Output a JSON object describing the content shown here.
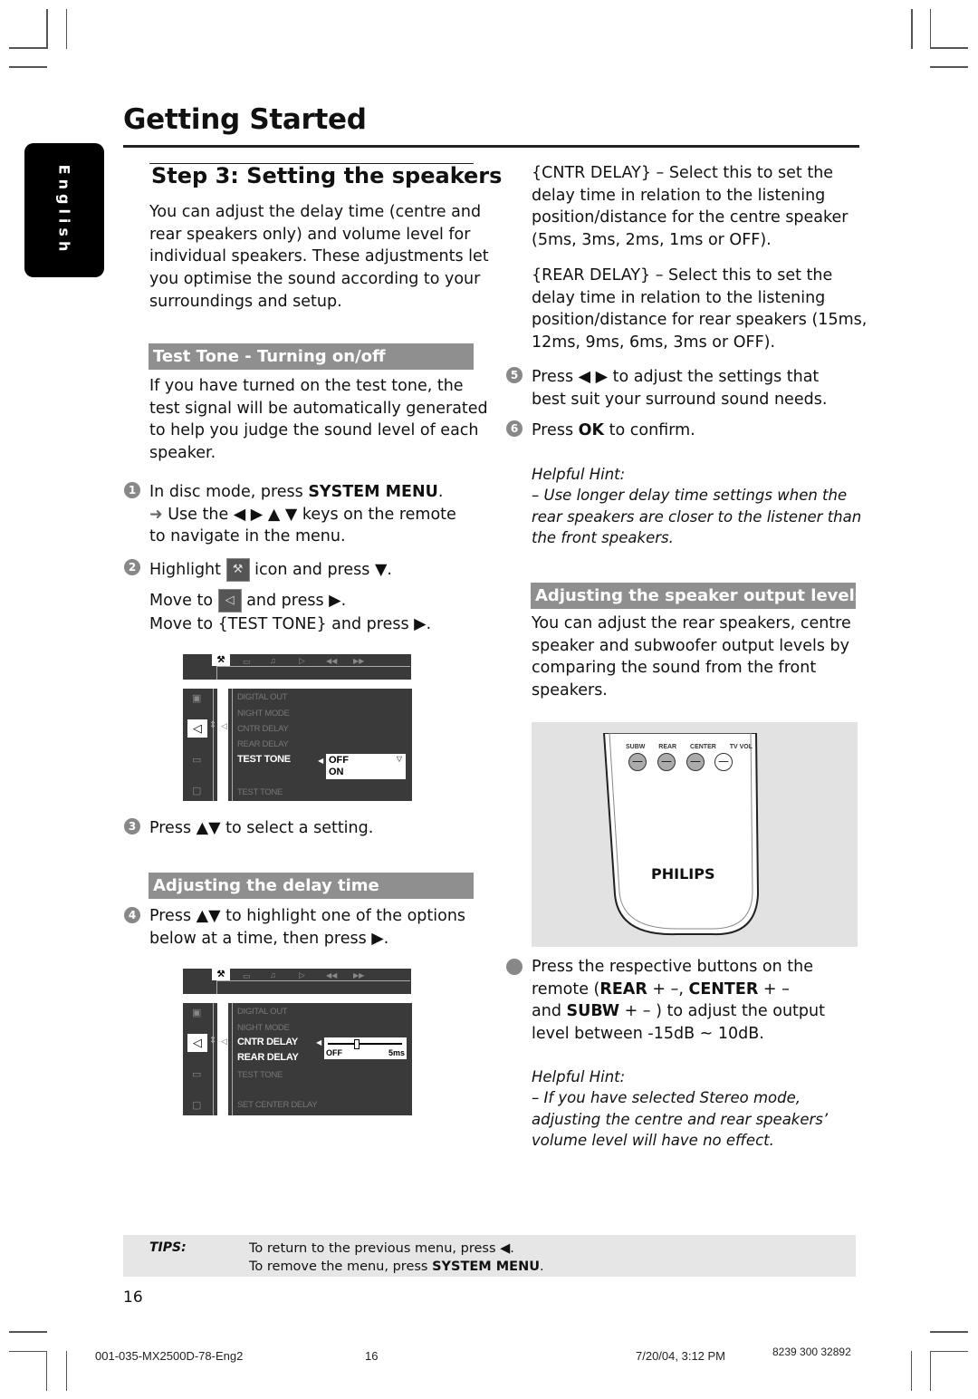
{
  "page": {
    "title": "Getting Started",
    "language_tab": "English",
    "page_number": "16"
  },
  "step": {
    "title": "Step 3:  Setting the speakers",
    "intro": [
      "You can adjust the delay time (centre and",
      "rear speakers only) and volume level for",
      "individual speakers. These adjustments let",
      "you optimise the sound according to your",
      "surroundings and setup."
    ]
  },
  "test_tone": {
    "heading": "Test Tone - Turning on/off",
    "intro": [
      "If you have turned on the test tone, the",
      "test signal will be automatically generated",
      "to help you judge the sound level of each",
      "speaker."
    ],
    "step1": {
      "num": "1",
      "text_a": "In disc mode, press ",
      "bold": "SYSTEM MENU",
      "text_b": ".",
      "arrow": "➜",
      "line2": "Use the ◀ ▶ ▲ ▼ keys on the remote",
      "line3": "to navigate in the menu."
    },
    "step2": {
      "num": "2",
      "a1": "Highlight ",
      "a2": " icon and press ▼.",
      "b1": "Move to ",
      "b2": " and press ▶.",
      "c": "Move to {TEST TONE} and press ▶."
    },
    "step3": {
      "num": "3",
      "text": "Press ▲▼ to select a setting."
    }
  },
  "osd1": {
    "tabs": [
      "settings-icon",
      "subtitle-icon",
      "audio-icon",
      "play-icon",
      "rewind-icon",
      "forward-icon"
    ],
    "menu": [
      "DIGITAL OUT",
      "NIGHT MODE",
      "CNTR DELAY",
      "REAR DELAY",
      "TEST TONE"
    ],
    "selected": "TEST TONE",
    "options": [
      "OFF",
      "ON"
    ],
    "footer": "TEST TONE"
  },
  "delay": {
    "heading": "Adjusting the delay time",
    "step4": {
      "num": "4",
      "line1": "Press ▲▼ to highlight one of the options",
      "line2": "below at a time, then press ▶."
    }
  },
  "osd2": {
    "menu": [
      "DIGITAL OUT",
      "NIGHT MODE",
      "CNTR DELAY",
      "REAR DELAY",
      "TEST TONE"
    ],
    "selected": [
      "CNTR DELAY",
      "REAR DELAY"
    ],
    "slider_min": "OFF",
    "slider_max": "5ms",
    "slider_value": 0.38,
    "footer": "SET CENTER DELAY"
  },
  "right": {
    "cntr": [
      "{CNTR DELAY} – Select this to set the",
      "delay time in relation to the listening",
      "position/distance for the centre speaker",
      "(5ms, 3ms, 2ms, 1ms or OFF)."
    ],
    "rear": [
      "{REAR DELAY} – Select this to set the",
      "delay time in relation to the listening",
      "position/distance for rear speakers (15ms,",
      "12ms, 9ms, 6ms, 3ms or OFF)."
    ],
    "step5": {
      "num": "5",
      "line1": "Press ◀ ▶  to adjust the settings that",
      "line2": "best suit your surround sound needs."
    },
    "step6": {
      "num": "6",
      "a": "Press ",
      "bold": "OK",
      "b": " to confirm."
    },
    "hint1": {
      "title": "Helpful Hint:",
      "lines": [
        "–  Use longer delay time settings when the",
        "rear speakers are closer to the listener than",
        "the front speakers."
      ]
    },
    "levels_heading": "Adjusting the speaker output levels",
    "levels_intro": [
      "You can adjust the rear speakers, centre",
      "speaker and subwoofer output levels by",
      "comparing the sound from the front",
      "speakers."
    ],
    "remote": {
      "labels": [
        "SUBW",
        "REAR",
        "CENTER",
        "TV VOL"
      ],
      "brand": "PHILIPS"
    },
    "bullet": {
      "l1": "Press the respective buttons on the",
      "l2a": "remote (",
      "l2b": "REAR",
      "l2c": " + –, ",
      "l2d": "CENTER",
      "l2e": " + –",
      "l3a": "and ",
      "l3b": "SUBW",
      "l3c": " + – ) to adjust the output",
      "l4": "level between -15dB ~ 10dB."
    },
    "hint2": {
      "title": "Helpful Hint:",
      "lines": [
        "–  If you have selected Stereo mode,",
        "adjusting the centre and rear speakers’",
        "volume level will have no effect."
      ]
    }
  },
  "tips": {
    "label": "TIPS:",
    "line1": "To return to the previous menu, press ◀.",
    "line2a": "To remove the menu, press ",
    "line2b": "SYSTEM MENU",
    "line2c": "."
  },
  "footer": {
    "file": "001-035-MX2500D-78-Eng2",
    "page": "16",
    "date": "7/20/04, 3:12 PM",
    "code": "8239 300 32892"
  }
}
